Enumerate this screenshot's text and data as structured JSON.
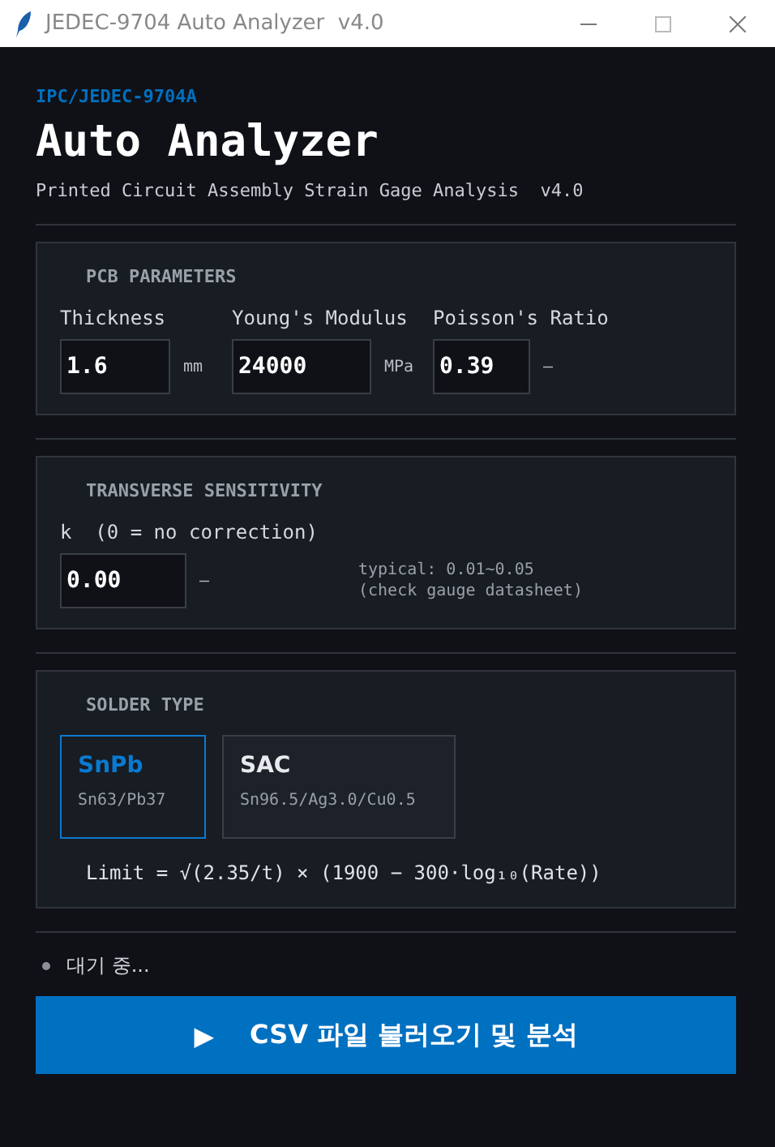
{
  "window": {
    "title": "JEDEC-9704 Auto Analyzer  v4.0"
  },
  "header": {
    "standard": "IPC/JEDEC-9704A",
    "title": "Auto Analyzer",
    "subtitle": "Printed Circuit Assembly Strain Gage Analysis  v4.0"
  },
  "pcb_parameters": {
    "heading": "PCB PARAMETERS",
    "fields": [
      {
        "label": "Thickness",
        "value": "1.6",
        "unit": "mm"
      },
      {
        "label": "Young's Modulus",
        "value": "24000",
        "unit": "MPa"
      },
      {
        "label": "Poisson's Ratio",
        "value": "0.39",
        "unit": "—"
      }
    ]
  },
  "transverse_sensitivity": {
    "heading": "TRANSVERSE SENSITIVITY",
    "label": "k  (0 = no correction)",
    "value": "0.00",
    "unit": "—",
    "hint": [
      "typical: 0.01~0.05",
      "(check gauge datasheet)"
    ]
  },
  "solder_type": {
    "heading": "SOLDER TYPE",
    "options": [
      {
        "name": "SnPb",
        "composition": "Sn63/Pb37",
        "selected": true
      },
      {
        "name": "SAC",
        "composition": "Sn96.5/Ag3.0/Cu0.5",
        "selected": false
      }
    ],
    "formula": "Limit = √(2.35/t) × (1900 − 300·log₁₀(Rate))"
  },
  "status": {
    "text": "대기 중...",
    "color": "#8b8f98"
  },
  "action_button": {
    "icon": "▶",
    "label": "CSV 파일 불러오기 및 분석"
  }
}
